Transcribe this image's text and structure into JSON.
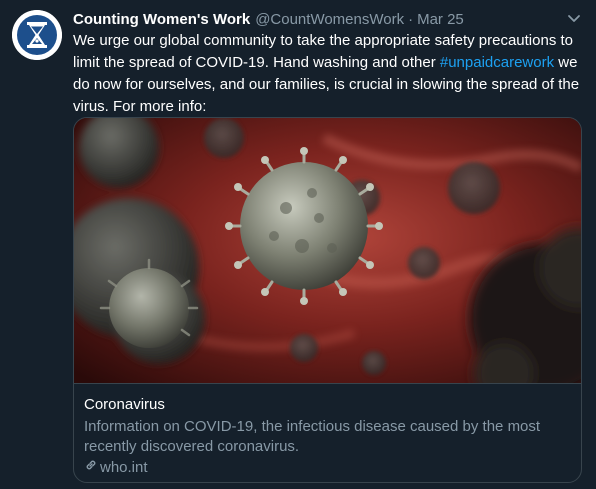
{
  "tweet": {
    "display_name": "Counting Women's Work",
    "handle": "@CountWomensWork",
    "separator": "·",
    "date": "Mar 25",
    "text_before": "We urge our global community to take the appropriate safety precautions to limit the spread of COVID-19. Hand washing and other ",
    "hashtag": "#unpaidcarework",
    "text_after": " we do now for ourselves, and our families, is crucial in slowing the spread of the virus. For more info:"
  },
  "card": {
    "image_icon": "coronavirus-illustration",
    "title": "Coronavirus",
    "description": "Information on COVID-19, the infectious disease caused by the most recently discovered coronavirus.",
    "link_icon": "link-icon",
    "domain": "who.int"
  },
  "colors": {
    "background": "#15202b",
    "secondary_text": "#8899a6",
    "link": "#1da1f2",
    "border": "#38444d",
    "avatar_blue": "#1d4f8c"
  }
}
